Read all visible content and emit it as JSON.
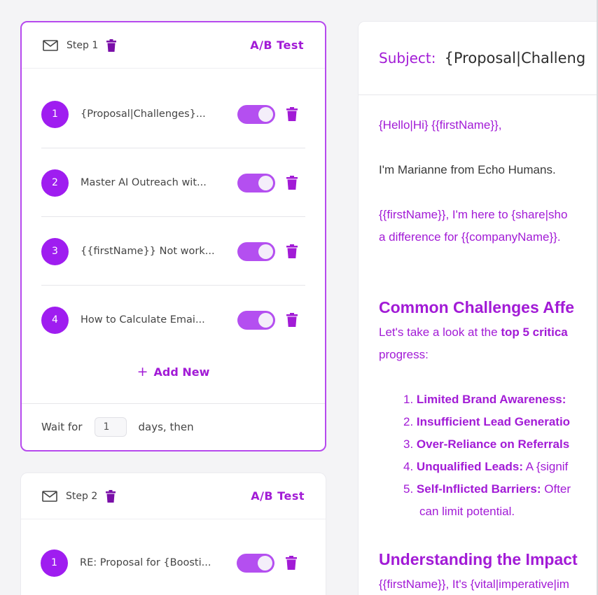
{
  "colors": {
    "accent": "#a21bd6",
    "toggle": "#b44ff0",
    "badge": "#9f1df0"
  },
  "steps": [
    {
      "label": "Step 1",
      "ab_test": "A/B Test",
      "variants": [
        {
          "num": "1",
          "title": "{Proposal|Challenges}...",
          "enabled": true
        },
        {
          "num": "2",
          "title": "Master AI Outreach wit...",
          "enabled": true
        },
        {
          "num": "3",
          "title": "{{firstName}} Not work...",
          "enabled": true
        },
        {
          "num": "4",
          "title": "How to Calculate Emai...",
          "enabled": true
        }
      ],
      "add_new": "Add New",
      "wait_prefix": "Wait for",
      "wait_value": "1",
      "wait_suffix": "days, then"
    },
    {
      "label": "Step 2",
      "ab_test": "A/B Test",
      "variants": [
        {
          "num": "1",
          "title": "RE: Proposal for {Boosti...",
          "enabled": true
        }
      ]
    }
  ],
  "editor": {
    "subject_label": "Subject:",
    "subject_value": "{Proposal|Challeng",
    "greeting": "{Hello|Hi} {{firstName}},",
    "intro": "I'm Marianne from Echo Humans.",
    "line3a": "{{firstName}}, I'm here to {share|sho",
    "line3b": "a difference for {{companyName}}.",
    "heading1": "Common Challenges Affe",
    "para1a_pre": "Let's take a look at the ",
    "para1a_bold": "top 5 critica",
    "para1b": "progress:",
    "list": [
      {
        "n": "1.",
        "bold": "Limited Brand Awareness:",
        "rest": ""
      },
      {
        "n": "2.",
        "bold": "Insufficient Lead Generatio",
        "rest": ""
      },
      {
        "n": "3.",
        "bold": "Over-Reliance on Referrals",
        "rest": ""
      },
      {
        "n": "4.",
        "bold": "Unqualified Leads:",
        "rest": " A {signif"
      },
      {
        "n": "5.",
        "bold": "Self-Inflicted Barriers:",
        "rest": " Ofter"
      }
    ],
    "list5_cont": "can limit potential.",
    "heading2": "Understanding the Impact",
    "para2": "{{firstName}}, It's {vital|imperative|im"
  }
}
